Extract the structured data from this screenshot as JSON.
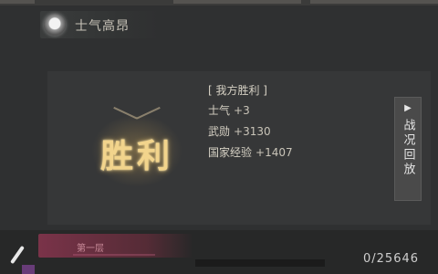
{
  "header": {
    "morale_label": "士气高昂",
    "morale_icon": "morale-badge-icon"
  },
  "result": {
    "victory_text": "胜利",
    "title": "[ 我方胜利 ]",
    "stats": [
      {
        "label": "士气",
        "value": "+3"
      },
      {
        "label": "武勋",
        "value": "+3130"
      },
      {
        "label": "国家经验",
        "value": "+1407"
      }
    ]
  },
  "replay": {
    "play_icon": "play-icon",
    "play_glyph": "▶",
    "label": "战况回放"
  },
  "footer": {
    "chat_icon": "quill-icon",
    "message": "第一层",
    "counter": "0/25646",
    "progress": 0.0
  },
  "colors": {
    "victory_gold": "#f2d48c",
    "panel_bg": "#363738",
    "page_bg": "#2f3031"
  }
}
